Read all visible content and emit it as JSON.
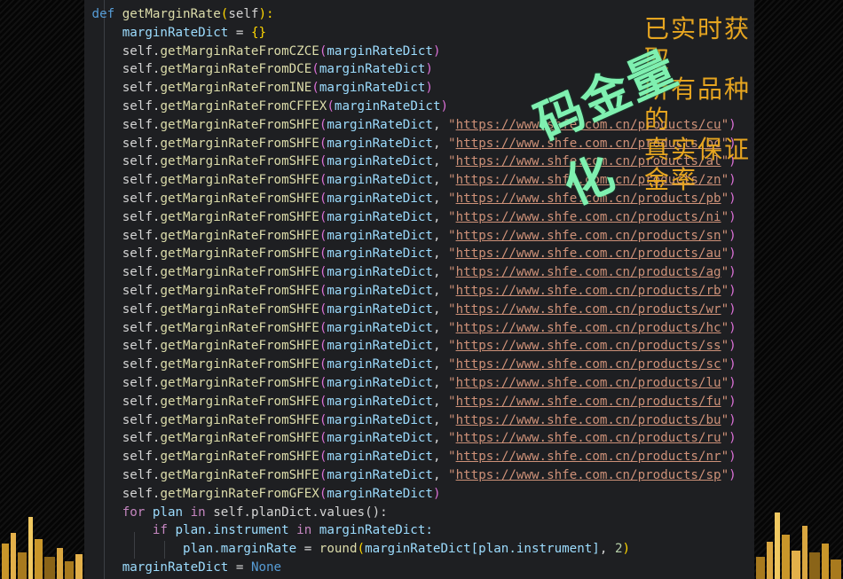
{
  "code": {
    "def_kw": "def",
    "func_name": "getMarginRate",
    "func_param": "self",
    "dict_name": "marginRateDict",
    "calls_single": [
      {
        "method": "getMarginRateFromCZCE"
      },
      {
        "method": "getMarginRateFromDCE"
      },
      {
        "method": "getMarginRateFromINE"
      },
      {
        "method": "getMarginRateFromCFFEX"
      }
    ],
    "shfe_method": "getMarginRateFromSHFE",
    "shfe_urls": [
      "https://www.shfe.com.cn/products/cu",
      "https://www.shfe.com.cn/products/bc",
      "https://www.shfe.com.cn/products/al",
      "https://www.shfe.com.cn/products/zn",
      "https://www.shfe.com.cn/products/pb",
      "https://www.shfe.com.cn/products/ni",
      "https://www.shfe.com.cn/products/sn",
      "https://www.shfe.com.cn/products/au",
      "https://www.shfe.com.cn/products/ag",
      "https://www.shfe.com.cn/products/rb",
      "https://www.shfe.com.cn/products/wr",
      "https://www.shfe.com.cn/products/hc",
      "https://www.shfe.com.cn/products/ss",
      "https://www.shfe.com.cn/products/sc",
      "https://www.shfe.com.cn/products/lu",
      "https://www.shfe.com.cn/products/fu",
      "https://www.shfe.com.cn/products/bu",
      "https://www.shfe.com.cn/products/ru",
      "https://www.shfe.com.cn/products/nr",
      "https://www.shfe.com.cn/products/sp"
    ],
    "gfex_method": "getMarginRateFromGFEX",
    "loop_line": {
      "for": "for",
      "var": "plan",
      "in": "in",
      "source": "self.planDict.values():"
    },
    "if_line": {
      "if": "if",
      "expr": "plan.instrument",
      "in": "in",
      "target": "marginRateDict:"
    },
    "assign_line": {
      "lhs": "plan.marginRate",
      "func": "round",
      "arg": "marginRateDict[plan.instrument]",
      "digits": "2"
    },
    "final_line": {
      "lhs": "marginRateDict",
      "rhs": "None"
    }
  },
  "overlay": {
    "lines": [
      "已实时获取",
      "所有品种的",
      "真实保证金率"
    ],
    "watermark": "码金量化"
  },
  "colors": {
    "editor_bg": "#1e1f22",
    "overlay_text": "#e6a520",
    "watermark": "#7ff0b0"
  }
}
